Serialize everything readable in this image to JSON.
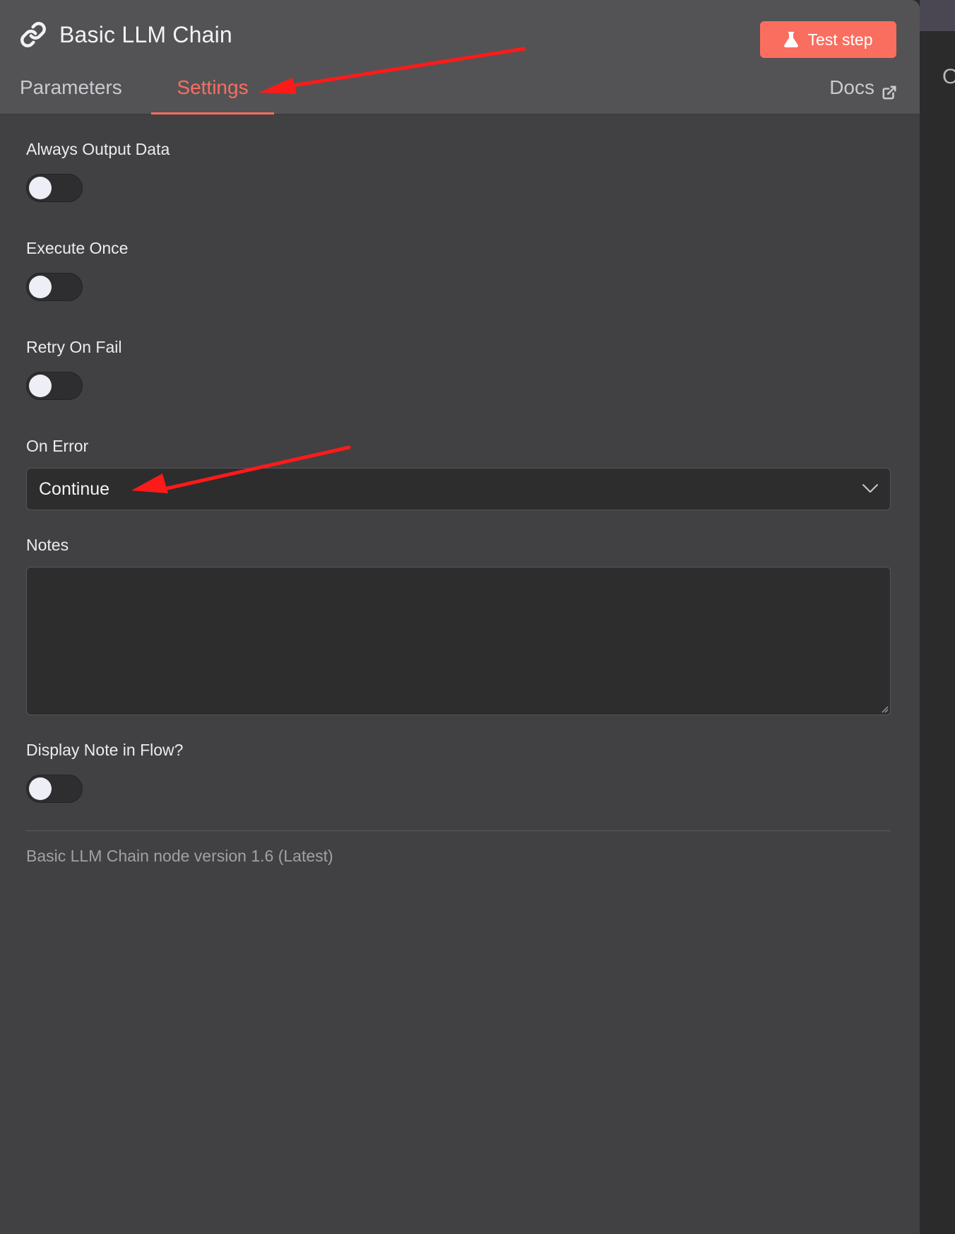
{
  "header": {
    "title": "Basic LLM Chain",
    "title_icon": "link-icon",
    "test_button_label": "Test step",
    "test_button_icon": "flask-icon",
    "accent_color": "#fa6e5f"
  },
  "tabs": [
    {
      "label": "Parameters",
      "active": false
    },
    {
      "label": "Settings",
      "active": true
    }
  ],
  "docs": {
    "label": "Docs",
    "icon": "external-link-icon"
  },
  "settings": {
    "always_output_data": {
      "label": "Always Output Data",
      "enabled": false
    },
    "execute_once": {
      "label": "Execute Once",
      "enabled": false
    },
    "retry_on_fail": {
      "label": "Retry On Fail",
      "enabled": false
    },
    "on_error": {
      "label": "On Error",
      "value": "Continue",
      "icon": "chevron-down-icon"
    },
    "notes": {
      "label": "Notes",
      "value": ""
    },
    "display_note_in_flow": {
      "label": "Display Note in Flow?",
      "enabled": false
    }
  },
  "footer": {
    "version_text": "Basic LLM Chain node version 1.6 (Latest)"
  },
  "canvas_peek_text": "O",
  "annotations": {
    "arrow_color": "#ff1a1a"
  }
}
